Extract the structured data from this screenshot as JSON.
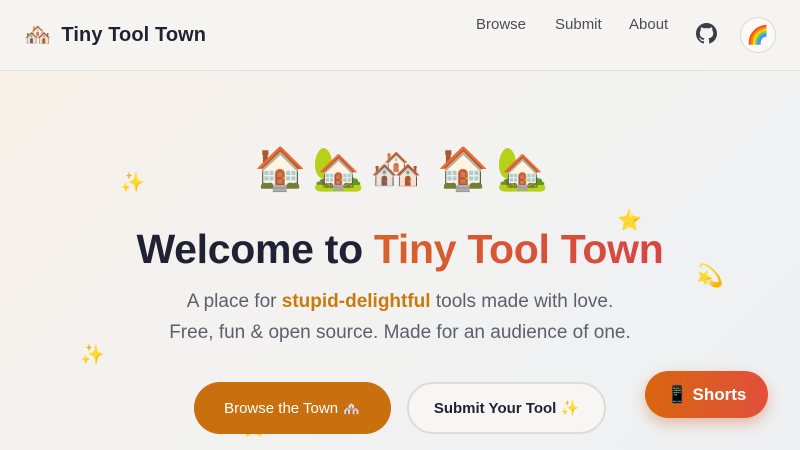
{
  "header": {
    "logo_icon": "🏘️",
    "logo_text": "Tiny Tool Town",
    "nav": [
      {
        "label": "Browse"
      },
      {
        "label": "Submit"
      },
      {
        "label": "About"
      }
    ],
    "github_icon": "github-icon",
    "theme_icon": "🌈"
  },
  "hero": {
    "houses": [
      "🏠",
      "🏡",
      "🏘️",
      "🏠",
      "🏡"
    ],
    "title_prefix": "Welcome to ",
    "title_accent": "Tiny Tool Town",
    "tagline_prefix": "A place for ",
    "tagline_highlight": "stupid-delightful",
    "tagline_suffix": " tools made with love.",
    "tagline2": "Free, fun & open source. Made for an audience of one.",
    "primary_button": "Browse the Town 🏘️",
    "secondary_button": "Submit Your Tool ✨",
    "decorations": [
      "✨",
      "⭐",
      "💫",
      "✨",
      "⭐"
    ]
  },
  "floating": {
    "shorts_label": "📱 Shorts"
  },
  "colors": {
    "accent_gradient_start": "#d9622a",
    "accent_gradient_end": "#d64545",
    "highlight": "#c97a0c",
    "primary_button": "#c96f0d",
    "title": "#1f2233"
  }
}
